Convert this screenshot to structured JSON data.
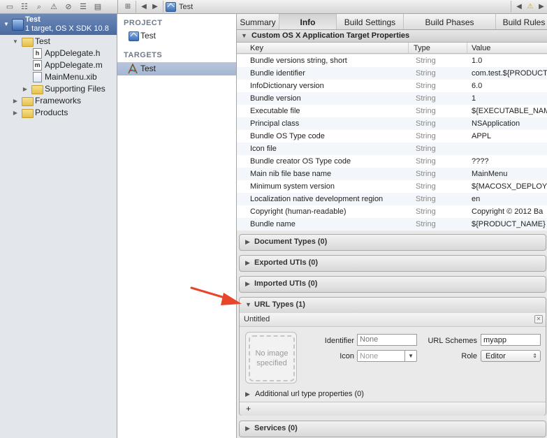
{
  "nav_toolbar": {
    "icons": [
      "folder-icon",
      "hierarchy-icon",
      "search-icon",
      "warning-icon",
      "breakpoint-icon",
      "list-icon",
      "message-icon"
    ]
  },
  "jump_bar": {
    "title": "Test"
  },
  "project_nav": {
    "name": "Test",
    "subtitle": "1 target, OS X SDK 10.8",
    "items": [
      {
        "label": "Test",
        "kind": "folder"
      },
      {
        "label": "AppDelegate.h",
        "kind": "file",
        "badge": "h"
      },
      {
        "label": "AppDelegate.m",
        "kind": "file",
        "badge": "m"
      },
      {
        "label": "MainMenu.xib",
        "kind": "file",
        "badge": ""
      },
      {
        "label": "Supporting Files",
        "kind": "folder"
      },
      {
        "label": "Frameworks",
        "kind": "folder"
      },
      {
        "label": "Products",
        "kind": "folder"
      }
    ]
  },
  "pt_list": {
    "project_header": "PROJECT",
    "project_item": "Test",
    "targets_header": "TARGETS",
    "target_item": "Test"
  },
  "tabs": [
    "Summary",
    "Info",
    "Build Settings",
    "Build Phases",
    "Build Rules"
  ],
  "props": {
    "header": "Custom OS X Application Target Properties",
    "col_key": "Key",
    "col_type": "Type",
    "col_value": "Value",
    "rows": [
      {
        "key": "Bundle versions string, short",
        "type": "String",
        "value": "1.0"
      },
      {
        "key": "Bundle identifier",
        "type": "String",
        "value": "com.test.${PRODUCT"
      },
      {
        "key": "InfoDictionary version",
        "type": "String",
        "value": "6.0"
      },
      {
        "key": "Bundle version",
        "type": "String",
        "value": "1"
      },
      {
        "key": "Executable file",
        "type": "String",
        "value": "${EXECUTABLE_NAM"
      },
      {
        "key": "Principal class",
        "type": "String",
        "value": "NSApplication"
      },
      {
        "key": "Bundle OS Type code",
        "type": "String",
        "value": "APPL"
      },
      {
        "key": "Icon file",
        "type": "String",
        "value": ""
      },
      {
        "key": "Bundle creator OS Type code",
        "type": "String",
        "value": "????"
      },
      {
        "key": "Main nib file base name",
        "type": "String",
        "value": "MainMenu"
      },
      {
        "key": "Minimum system version",
        "type": "String",
        "value": "${MACOSX_DEPLOYM"
      },
      {
        "key": "Localization native development region",
        "type": "String",
        "value": "en"
      },
      {
        "key": "Copyright (human-readable)",
        "type": "String",
        "value": "Copyright © 2012 Ba"
      },
      {
        "key": "Bundle name",
        "type": "String",
        "value": "${PRODUCT_NAME}"
      }
    ]
  },
  "sections": {
    "document_types": "Document Types (0)",
    "exported_utis": "Exported UTIs (0)",
    "imported_utis": "Imported UTIs (0)",
    "url_types": "URL Types (1)",
    "services": "Services (0)"
  },
  "url_type": {
    "title": "Untitled",
    "no_image": "No image specified",
    "identifier_label": "Identifier",
    "identifier_placeholder": "None",
    "icon_label": "Icon",
    "icon_value": "None",
    "schemes_label": "URL Schemes",
    "schemes_value": "myapp",
    "role_label": "Role",
    "role_value": "Editor",
    "additional": "Additional url type properties (0)",
    "add_symbol": "+"
  },
  "colors": {
    "annotation_arrow": "#e8462a",
    "selection": "#b2c0d8"
  }
}
